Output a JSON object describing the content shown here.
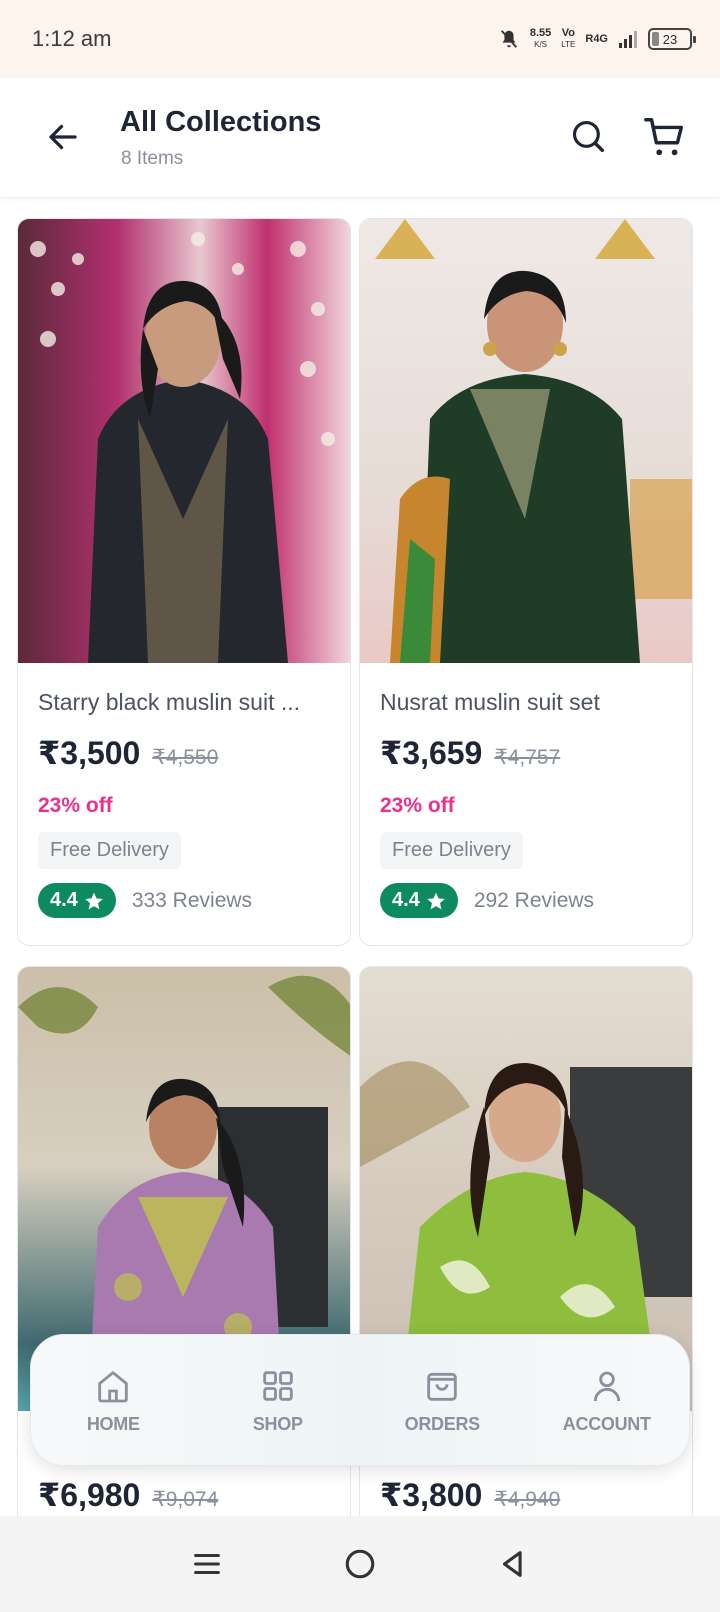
{
  "status_bar": {
    "time": "1:12 am",
    "speed": "8.55",
    "speed_unit": "K/S",
    "volte": "Vo",
    "volte_sub": "LTE",
    "network": "R4G",
    "battery": "23"
  },
  "header": {
    "title": "All Collections",
    "subtitle": "8 Items"
  },
  "products": [
    {
      "name": "Starry black muslin suit ...",
      "price": "₹3,500",
      "mrp": "₹4,550",
      "discount": "23% off",
      "delivery": "Free Delivery",
      "rating": "4.4",
      "reviews": "333 Reviews"
    },
    {
      "name": "Nusrat muslin suit set",
      "price": "₹3,659",
      "mrp": "₹4,757",
      "discount": "23% off",
      "delivery": "Free Delivery",
      "rating": "4.4",
      "reviews": "292 Reviews"
    },
    {
      "price": "₹6,980",
      "mrp": "₹9,074"
    },
    {
      "price": "₹3,800",
      "mrp": "₹4,940"
    }
  ],
  "bottom_nav": {
    "home": "HOME",
    "shop": "SHOP",
    "orders": "ORDERS",
    "account": "ACCOUNT"
  },
  "colors": {
    "discount": "#e8318a",
    "rating": "#0e8a5f",
    "status_bg": "#fdf4ee"
  }
}
